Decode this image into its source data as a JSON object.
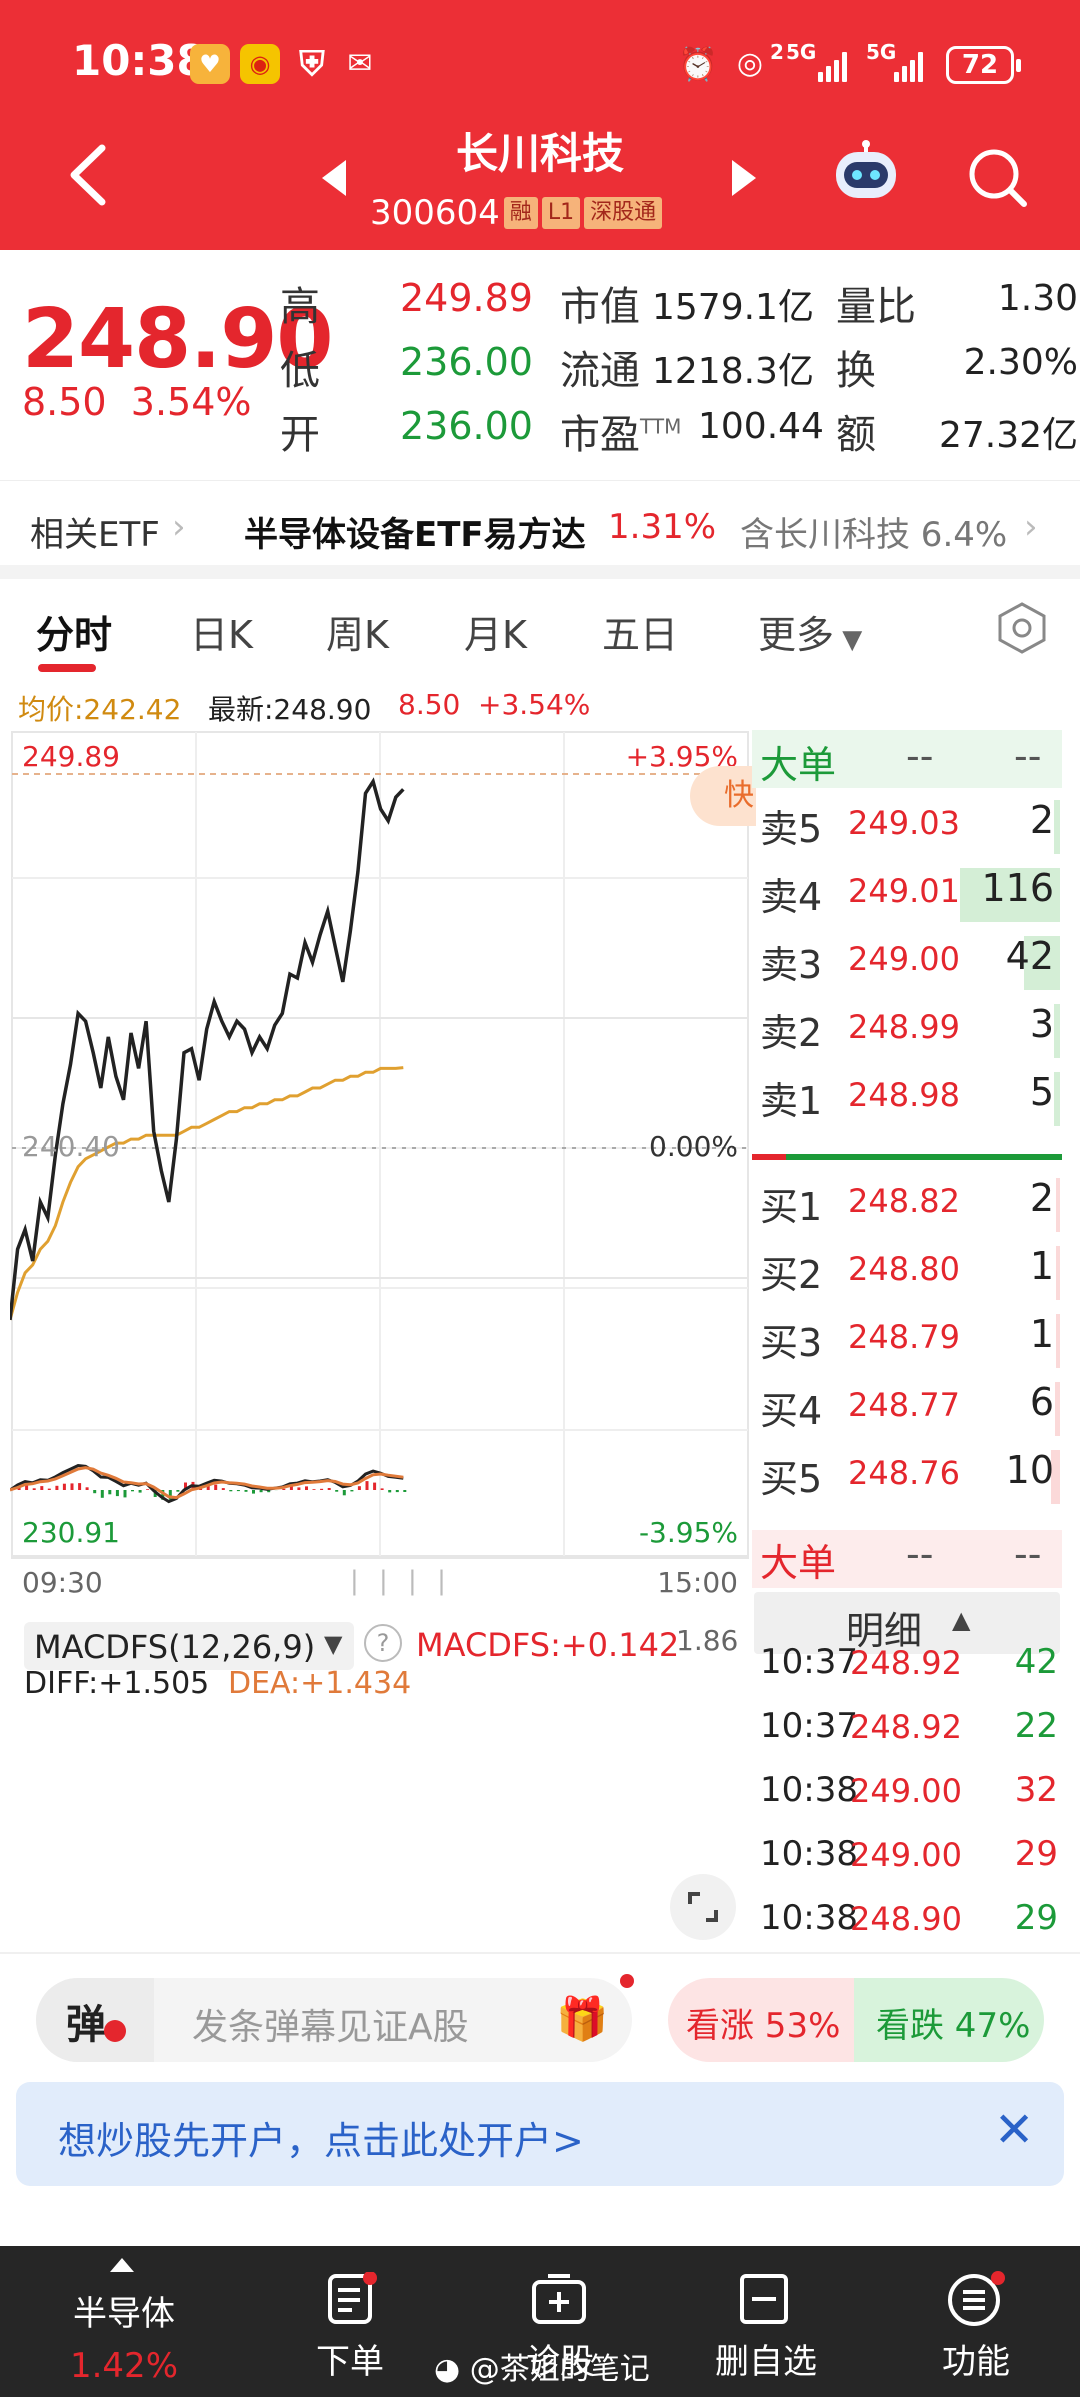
{
  "status": {
    "time": "10:38",
    "battery": "72",
    "net1": "2",
    "net2": "5G",
    "net3": "5G"
  },
  "header": {
    "title": "长川科技",
    "code": "300604",
    "tags": [
      "融",
      "L1",
      "深股通"
    ]
  },
  "quote": {
    "price": "248.90",
    "change": "8.50",
    "change_pct": "3.54%",
    "high_label": "高",
    "high": "249.89",
    "low_label": "低",
    "low": "236.00",
    "open_label": "开",
    "open": "236.00",
    "mcap_label": "市值",
    "mcap": "1579.1亿",
    "float_label": "流通",
    "float": "1218.3亿",
    "pe_label": "市盈",
    "pe_sup": "TTM",
    "pe": "100.44",
    "vr_label": "量比",
    "vr": "1.30",
    "turn_label": "换",
    "turn": "2.30%",
    "amt_label": "额",
    "amt": "27.32亿"
  },
  "etf": {
    "label": "相关ETF",
    "name": "半导体设备ETF易方达",
    "pct": "1.31%",
    "hold": "含长川科技 6.4%"
  },
  "tabs": [
    "分时",
    "日K",
    "周K",
    "月K",
    "五日",
    "更多"
  ],
  "info": {
    "avg": "均价:242.42",
    "latest": "最新:248.90",
    "chg": "8.50",
    "pct": "+3.54%"
  },
  "chart_labels": {
    "top_price": "249.89",
    "top_pct": "+3.95%",
    "mid_price": "240.40",
    "mid_pct": "0.00%",
    "bottom_price": "230.91",
    "bottom_pct": "-3.95%",
    "start_time": "09:30",
    "end_time": "15:00",
    "fast_badge": "快"
  },
  "macd": {
    "name": "MACDFS(12,26,9)",
    "value": "MACDFS:+0.142",
    "diff": "DIFF:+1.505",
    "dea": "DEA:+1.434",
    "scale": "1.86"
  },
  "chart_data": {
    "type": "line",
    "x_label_start": "09:30",
    "x_label_end": "15:00",
    "ylim": [
      230.91,
      249.89
    ],
    "base": 240.4,
    "series": [
      {
        "values": [
          236.0,
          237.8,
          238.3,
          237.5,
          239.0,
          238.6,
          240.2,
          241.5,
          242.5,
          243.8,
          243.6,
          242.8,
          241.9,
          243.2,
          242.2,
          241.6,
          243.3,
          242.4,
          243.6,
          240.8,
          239.8,
          239.0,
          240.6,
          242.8,
          242.9,
          242.1,
          243.4,
          244.1,
          243.6,
          243.2,
          243.6,
          243.4,
          242.8,
          243.2,
          242.9,
          243.5,
          243.8,
          244.8,
          244.7,
          245.6,
          245.1,
          245.8,
          246.4,
          245.5,
          244.6,
          245.9,
          247.4,
          249.4,
          249.7,
          249.0,
          248.7,
          249.3,
          249.5
        ]
      },
      {
        "values": [
          236.0,
          236.7,
          237.2,
          237.4,
          237.8,
          238.0,
          238.4,
          239.0,
          239.5,
          239.9,
          240.1,
          240.2,
          240.3,
          240.4,
          240.5,
          240.5,
          240.6,
          240.6,
          240.7,
          240.7,
          240.7,
          240.7,
          240.7,
          240.8,
          240.9,
          240.9,
          241.0,
          241.1,
          241.2,
          241.3,
          241.3,
          241.4,
          241.4,
          241.5,
          241.5,
          241.6,
          241.6,
          241.7,
          241.7,
          241.8,
          241.9,
          241.9,
          242.0,
          242.1,
          242.1,
          242.2,
          242.2,
          242.3,
          242.3,
          242.4,
          242.4,
          242.4,
          242.42
        ]
      }
    ]
  },
  "orderbook": {
    "big_label": "大单",
    "dash": "--",
    "asks": [
      {
        "label": "卖5",
        "price": "249.03",
        "vol": "2"
      },
      {
        "label": "卖4",
        "price": "249.01",
        "vol": "116"
      },
      {
        "label": "卖3",
        "price": "249.00",
        "vol": "42"
      },
      {
        "label": "卖2",
        "price": "248.99",
        "vol": "3"
      },
      {
        "label": "卖1",
        "price": "248.98",
        "vol": "5"
      }
    ],
    "bids": [
      {
        "label": "买1",
        "price": "248.82",
        "vol": "2"
      },
      {
        "label": "买2",
        "price": "248.80",
        "vol": "1"
      },
      {
        "label": "买3",
        "price": "248.79",
        "vol": "1"
      },
      {
        "label": "买4",
        "price": "248.77",
        "vol": "6"
      },
      {
        "label": "买5",
        "price": "248.76",
        "vol": "10"
      }
    ],
    "detail_label": "明细",
    "trades": [
      {
        "time": "10:37",
        "price": "248.92",
        "vol": "42"
      },
      {
        "time": "10:37",
        "price": "248.92",
        "vol": "22"
      },
      {
        "time": "10:38",
        "price": "249.00",
        "vol": "32"
      },
      {
        "time": "10:38",
        "price": "249.00",
        "vol": "29"
      },
      {
        "time": "10:38",
        "price": "248.90",
        "vol": "29"
      }
    ]
  },
  "bottom": {
    "danmu_label": "弹",
    "danmu_placeholder": "发条弹幕见证A股",
    "vote_up": "看涨 53%",
    "vote_down": "看跌 47%",
    "open_account": "想炒股先开户，点击此处开户>"
  },
  "nav": {
    "sector": "半导体",
    "sector_pct": "1.42%",
    "order": "下单",
    "diag": "诊股",
    "remove": "删自选",
    "func": "功能",
    "watermark": "@茶姐的笔记"
  },
  "colors": {
    "brand_red": "#ec2f36",
    "up_red": "#e4262d",
    "down_green": "#1c9a39",
    "avg_line": "#e0a030"
  }
}
